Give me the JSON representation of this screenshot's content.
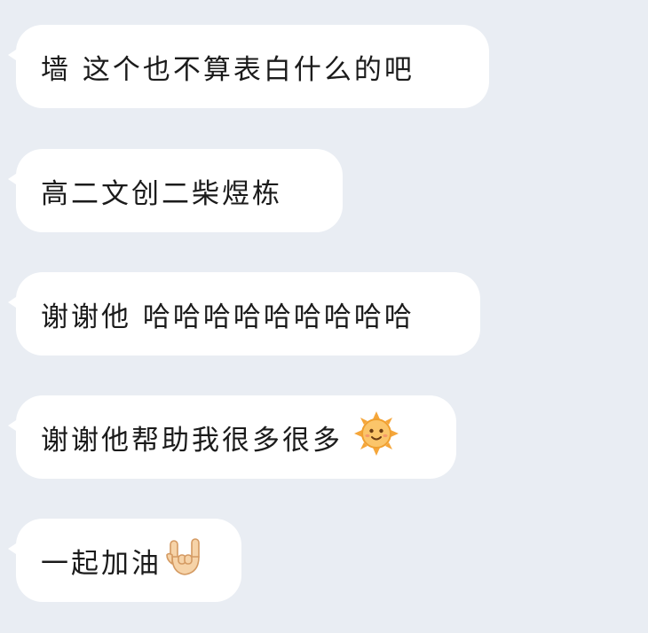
{
  "messages": [
    {
      "text": "墙 这个也不算表白什么的吧"
    },
    {
      "text": "高二文创二柴煜栋"
    },
    {
      "text": "谢谢他 哈哈哈哈哈哈哈哈哈"
    },
    {
      "text": "谢谢他帮助我很多很多",
      "emoji": "sun-face-emoji"
    },
    {
      "text": "一起加油",
      "emoji": "rock-on-hand-emoji"
    }
  ],
  "colors": {
    "background": "#e9edf3",
    "bubble": "#ffffff",
    "text": "#1b1b1b"
  }
}
